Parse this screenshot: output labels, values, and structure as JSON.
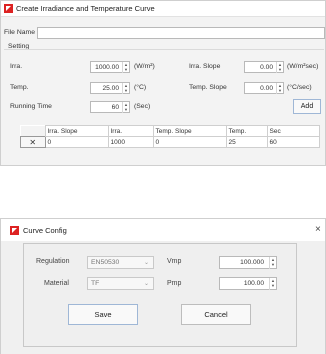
{
  "window1": {
    "title": "Create Irradiance and Temperature Curve",
    "file_name_label": "File Name",
    "file_name_value": "",
    "setting_label": "Setting",
    "irra_label": "Irra.",
    "irra_value": "1000.00",
    "irra_unit": "(W/m²)",
    "irra_slope_label": "Irra. Slope",
    "irra_slope_value": "0.00",
    "irra_slope_unit": "(W/m²sec)",
    "temp_label": "Temp.",
    "temp_value": "25.00",
    "temp_unit": "(°C)",
    "temp_slope_label": "Temp. Slope",
    "temp_slope_value": "0.00",
    "temp_slope_unit": "(°C/sec)",
    "running_time_label": "Running Time",
    "running_time_value": "60",
    "running_time_unit": "(Sec)",
    "add_label": "Add",
    "table": {
      "headers": [
        "",
        "Irra. Slope",
        "Irra.",
        "Temp. Slope",
        "Temp.",
        "Sec"
      ],
      "rows": [
        {
          "action": "✕",
          "cells": [
            "0",
            "1000",
            "0",
            "25",
            "60"
          ]
        }
      ]
    }
  },
  "window2": {
    "title": "Curve Config",
    "close": "×",
    "regulation_label": "Regulation",
    "regulation_value": "EN50530",
    "material_label": "Material",
    "material_value": "TF",
    "vmp_label": "Vmp",
    "vmp_value": "100.000",
    "pmp_label": "Pmp",
    "pmp_value": "100.00",
    "save_label": "Save",
    "cancel_label": "Cancel"
  },
  "colors": {
    "app_icon": "#dd2222",
    "button_border": "#9fb7d6"
  },
  "icons": {
    "app": "app-icon",
    "spin": "spin-updown-icon",
    "delete": "delete-x-icon",
    "dropdown": "chevron-down-icon",
    "close": "close-icon"
  }
}
